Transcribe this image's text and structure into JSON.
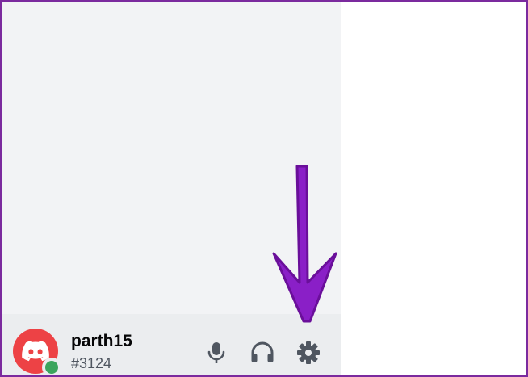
{
  "user": {
    "username": "parth15",
    "tag": "#3124",
    "status": "online"
  },
  "controls": {
    "mic_icon": "microphone-icon",
    "headset_icon": "headphones-icon",
    "settings_icon": "gear-icon"
  },
  "colors": {
    "frame_border": "#7b2a9e",
    "sidebar_bg": "#f2f3f5",
    "user_panel_bg": "#ebedef",
    "avatar_bg": "#ed4245",
    "status_online": "#3ba55d",
    "icon_color": "#4f5660",
    "annotation_arrow": "#8a1fc7"
  }
}
